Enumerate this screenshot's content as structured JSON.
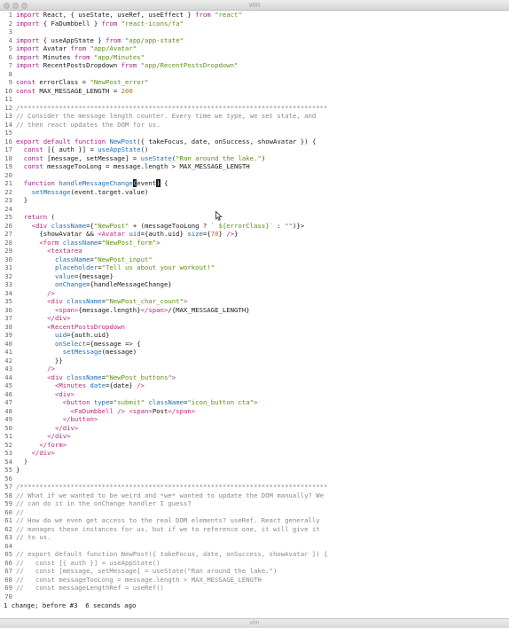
{
  "window": {
    "title": "vim",
    "footer_title": "vim"
  },
  "colors": {
    "keyword": "#a0218a",
    "string": "#5e8f15",
    "comment": "#8a8a8a",
    "function": "#1f6fb2",
    "jsx": "#b42a7a",
    "number": "#c06a00"
  },
  "icons": {
    "mouse_pointer": "arrow-pointer-icon"
  },
  "editor": {
    "lines": [
      [
        [
          "k",
          "import"
        ],
        [
          "b",
          " React, { useState, useRef, useEffect } "
        ],
        [
          "k",
          "from"
        ],
        [
          "b",
          " "
        ],
        [
          "s",
          "\"react\""
        ]
      ],
      [
        [
          "k",
          "import"
        ],
        [
          "b",
          " { FaDumbbell } "
        ],
        [
          "k",
          "from"
        ],
        [
          "b",
          " "
        ],
        [
          "s",
          "\"react-icons/fa\""
        ]
      ],
      [],
      [
        [
          "k",
          "import"
        ],
        [
          "b",
          " { useAppState } "
        ],
        [
          "k",
          "from"
        ],
        [
          "b",
          " "
        ],
        [
          "s",
          "\"app/app-state\""
        ]
      ],
      [
        [
          "k",
          "import"
        ],
        [
          "b",
          " Avatar "
        ],
        [
          "k",
          "from"
        ],
        [
          "b",
          " "
        ],
        [
          "s",
          "\"app/Avatar\""
        ]
      ],
      [
        [
          "k",
          "import"
        ],
        [
          "b",
          " Minutes "
        ],
        [
          "k",
          "from"
        ],
        [
          "b",
          " "
        ],
        [
          "s",
          "\"app/Minutes\""
        ]
      ],
      [
        [
          "k",
          "import"
        ],
        [
          "b",
          " RecentPostsDropdown "
        ],
        [
          "k",
          "from"
        ],
        [
          "b",
          " "
        ],
        [
          "s",
          "\"app/RecentPostsDropdown\""
        ]
      ],
      [],
      [
        [
          "k",
          "const"
        ],
        [
          "b",
          " errorClass = "
        ],
        [
          "s",
          "\"NewPost_error\""
        ]
      ],
      [
        [
          "k",
          "const"
        ],
        [
          "b",
          " MAX_MESSAGE_LENGTH = "
        ],
        [
          "n",
          "200"
        ]
      ],
      [],
      [
        [
          "c",
          "/*******************************************************************************"
        ]
      ],
      [
        [
          "c",
          "// Consider the message length counter. Every time we type, we set state, and"
        ]
      ],
      [
        [
          "c",
          "// then react updates the DOM for us."
        ]
      ],
      [],
      [
        [
          "k",
          "export"
        ],
        [
          "b",
          " "
        ],
        [
          "k",
          "default"
        ],
        [
          "b",
          " "
        ],
        [
          "k",
          "function"
        ],
        [
          "b",
          " "
        ],
        [
          "f",
          "NewPost"
        ],
        [
          "b",
          "({ takeFocus, date, onSuccess, showAvatar }) {"
        ]
      ],
      [
        [
          "b",
          "  "
        ],
        [
          "k",
          "const"
        ],
        [
          "b",
          " [{ auth }] = "
        ],
        [
          "f",
          "useAppState"
        ],
        [
          "b",
          "()"
        ]
      ],
      [
        [
          "b",
          "  "
        ],
        [
          "k",
          "const"
        ],
        [
          "b",
          " [message, setMessage] = "
        ],
        [
          "f",
          "useState"
        ],
        [
          "b",
          "("
        ],
        [
          "s",
          "\"Ran around the lake.\""
        ],
        [
          "b",
          ")"
        ]
      ],
      [
        [
          "b",
          "  "
        ],
        [
          "k",
          "const"
        ],
        [
          "b",
          " messageTooLong = message.length > MAX_MESSAGE_LENGTH"
        ]
      ],
      [],
      [
        [
          "b",
          "  "
        ],
        [
          "k",
          "function"
        ],
        [
          "b",
          " "
        ],
        [
          "f",
          "handleMessageChange"
        ],
        [
          "cur",
          "("
        ],
        [
          "b",
          "event"
        ],
        [
          "cur",
          ")"
        ],
        [
          "b",
          " {"
        ]
      ],
      [
        [
          "b",
          "    "
        ],
        [
          "f",
          "setMessage"
        ],
        [
          "b",
          "(event.target.value)"
        ]
      ],
      [
        [
          "b",
          "  }"
        ]
      ],
      [],
      [
        [
          "b",
          "  "
        ],
        [
          "k",
          "return"
        ],
        [
          "b",
          " ("
        ]
      ],
      [
        [
          "b",
          "    "
        ],
        [
          "j",
          "<div"
        ],
        [
          "b",
          " "
        ],
        [
          "f",
          "className"
        ],
        [
          "b",
          "={"
        ],
        [
          "s",
          "\"NewPost\""
        ],
        [
          "b",
          " + (messageTooLong ? "
        ],
        [
          "s",
          "` ${errorClass}`"
        ],
        [
          "b",
          " : "
        ],
        [
          "s",
          "\"\""
        ],
        [
          "b",
          ")}>"
        ]
      ],
      [
        [
          "b",
          "      {showAvatar && "
        ],
        [
          "j",
          "<Avatar"
        ],
        [
          "b",
          " "
        ],
        [
          "f",
          "uid"
        ],
        [
          "b",
          "={auth.uid} "
        ],
        [
          "f",
          "size"
        ],
        [
          "b",
          "={"
        ],
        [
          "n",
          "70"
        ],
        [
          "b",
          "} "
        ],
        [
          "j",
          "/>"
        ],
        [
          "b",
          "}"
        ]
      ],
      [
        [
          "b",
          "      "
        ],
        [
          "j",
          "<form"
        ],
        [
          "b",
          " "
        ],
        [
          "f",
          "className"
        ],
        [
          "b",
          "="
        ],
        [
          "s",
          "\"NewPost_form\""
        ],
        [
          "j",
          ">"
        ]
      ],
      [
        [
          "b",
          "        "
        ],
        [
          "j",
          "<textarea"
        ]
      ],
      [
        [
          "b",
          "          "
        ],
        [
          "f",
          "className"
        ],
        [
          "b",
          "="
        ],
        [
          "s",
          "\"NewPost_input\""
        ]
      ],
      [
        [
          "b",
          "          "
        ],
        [
          "f",
          "placeholder"
        ],
        [
          "b",
          "="
        ],
        [
          "s",
          "\"Tell us about your workout!\""
        ]
      ],
      [
        [
          "b",
          "          "
        ],
        [
          "f",
          "value"
        ],
        [
          "b",
          "={message}"
        ]
      ],
      [
        [
          "b",
          "          "
        ],
        [
          "f",
          "onChange"
        ],
        [
          "b",
          "={handleMessageChange}"
        ]
      ],
      [
        [
          "b",
          "        "
        ],
        [
          "j",
          "/>"
        ]
      ],
      [
        [
          "b",
          "        "
        ],
        [
          "j",
          "<div"
        ],
        [
          "b",
          " "
        ],
        [
          "f",
          "className"
        ],
        [
          "b",
          "="
        ],
        [
          "s",
          "\"NewPost_char_count\""
        ],
        [
          "j",
          ">"
        ]
      ],
      [
        [
          "b",
          "          "
        ],
        [
          "j",
          "<span>"
        ],
        [
          "b",
          "{message.length}"
        ],
        [
          "j",
          "</span>"
        ],
        [
          "b",
          "/{MAX_MESSAGE_LENGTH}"
        ]
      ],
      [
        [
          "b",
          "        "
        ],
        [
          "j",
          "</div>"
        ]
      ],
      [
        [
          "b",
          "        "
        ],
        [
          "j",
          "<RecentPostsDropdown"
        ]
      ],
      [
        [
          "b",
          "          "
        ],
        [
          "f",
          "uid"
        ],
        [
          "b",
          "={auth.uid}"
        ]
      ],
      [
        [
          "b",
          "          "
        ],
        [
          "f",
          "onSelect"
        ],
        [
          "b",
          "={message => {"
        ]
      ],
      [
        [
          "b",
          "            "
        ],
        [
          "f",
          "setMessage"
        ],
        [
          "b",
          "(message)"
        ]
      ],
      [
        [
          "b",
          "          }}"
        ]
      ],
      [
        [
          "b",
          "        "
        ],
        [
          "j",
          "/>"
        ]
      ],
      [
        [
          "b",
          "        "
        ],
        [
          "j",
          "<div"
        ],
        [
          "b",
          " "
        ],
        [
          "f",
          "className"
        ],
        [
          "b",
          "="
        ],
        [
          "s",
          "\"NewPost_buttons\""
        ],
        [
          "j",
          ">"
        ]
      ],
      [
        [
          "b",
          "          "
        ],
        [
          "j",
          "<Minutes"
        ],
        [
          "b",
          " "
        ],
        [
          "f",
          "date"
        ],
        [
          "b",
          "={date} "
        ],
        [
          "j",
          "/>"
        ]
      ],
      [
        [
          "b",
          "          "
        ],
        [
          "j",
          "<div>"
        ]
      ],
      [
        [
          "b",
          "            "
        ],
        [
          "j",
          "<button"
        ],
        [
          "b",
          " "
        ],
        [
          "f",
          "type"
        ],
        [
          "b",
          "="
        ],
        [
          "s",
          "\"submit\""
        ],
        [
          "b",
          " "
        ],
        [
          "f",
          "className"
        ],
        [
          "b",
          "="
        ],
        [
          "s",
          "\"icon_button cta\""
        ],
        [
          "j",
          ">"
        ]
      ],
      [
        [
          "b",
          "              "
        ],
        [
          "j",
          "<FaDumbbell"
        ],
        [
          "b",
          " "
        ],
        [
          "j",
          "/>"
        ],
        [
          "b",
          " "
        ],
        [
          "j",
          "<span>"
        ],
        [
          "b",
          "Post"
        ],
        [
          "j",
          "</span>"
        ]
      ],
      [
        [
          "b",
          "            "
        ],
        [
          "j",
          "</button>"
        ]
      ],
      [
        [
          "b",
          "          "
        ],
        [
          "j",
          "</div>"
        ]
      ],
      [
        [
          "b",
          "        "
        ],
        [
          "j",
          "</div>"
        ]
      ],
      [
        [
          "b",
          "      "
        ],
        [
          "j",
          "</form>"
        ]
      ],
      [
        [
          "b",
          "    "
        ],
        [
          "j",
          "</div>"
        ]
      ],
      [
        [
          "b",
          "  )"
        ]
      ],
      [
        [
          "b",
          "}"
        ]
      ],
      [],
      [
        [
          "c",
          "/*******************************************************************************"
        ]
      ],
      [
        [
          "c",
          "// What if we wanted to be weird and *we* wanted to update the DOM manually? We"
        ]
      ],
      [
        [
          "c",
          "// can do it in the onChange handler I guess?"
        ]
      ],
      [
        [
          "c",
          "//"
        ]
      ],
      [
        [
          "c",
          "// How do we even get access to the real DOM elements? useRef. React generally"
        ]
      ],
      [
        [
          "c",
          "// manages these instances for us, but if we to reference one, it will give it"
        ]
      ],
      [
        [
          "c",
          "// to us."
        ]
      ],
      [],
      [
        [
          "c",
          "// export default function NewPost({ takeFocus, date, onSuccess, showAvatar }) {"
        ]
      ],
      [
        [
          "c",
          "//   const [{ auth }] = useAppState()"
        ]
      ],
      [
        [
          "c",
          "//   const [message, setMessage] = useState(\"Ran around the lake.\")"
        ]
      ],
      [
        [
          "c",
          "//   const messageTooLong = message.length > MAX_MESSAGE_LENGTH"
        ]
      ],
      [
        [
          "c",
          "//   const messageLengthRef = useRef()"
        ]
      ],
      []
    ]
  },
  "status": {
    "message": "1 change; before #3  6 seconds ago"
  }
}
